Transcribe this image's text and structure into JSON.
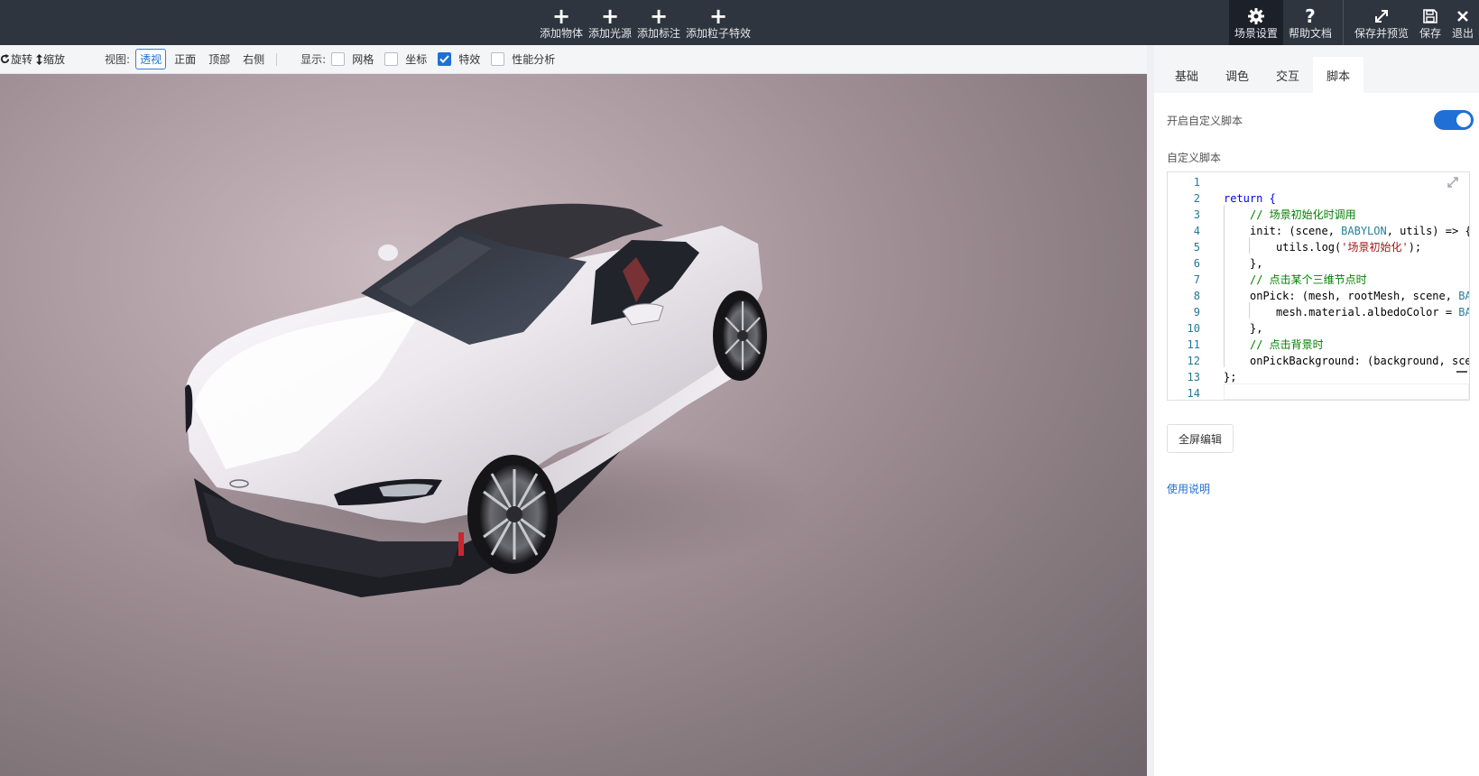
{
  "toolbar": {
    "add_object": "添加物体",
    "add_light": "添加光源",
    "add_label": "添加标注",
    "add_particle": "添加粒子特效",
    "scene_settings": "场景设置",
    "help_docs": "帮助文档",
    "save_preview": "保存并预览",
    "save": "保存",
    "exit": "退出"
  },
  "subbar": {
    "rotate": "旋转",
    "zoom": "缩放",
    "view_label": "视图:",
    "views": [
      "透视",
      "正面",
      "顶部",
      "右侧"
    ],
    "active_view": "透视",
    "display_label": "显示:",
    "options": [
      {
        "label": "网格",
        "checked": false
      },
      {
        "label": "坐标",
        "checked": false
      },
      {
        "label": "特效",
        "checked": true
      },
      {
        "label": "性能分析",
        "checked": false
      }
    ]
  },
  "panel": {
    "tabs": [
      "基础",
      "调色",
      "交互",
      "脚本"
    ],
    "active_tab": "脚本",
    "enable_script_label": "开启自定义脚本",
    "enable_script_on": true,
    "custom_script_label": "自定义脚本",
    "fullscreen_button": "全屏编辑",
    "usage_link": "使用说明"
  },
  "code": {
    "line_numbers": [
      "1",
      "2",
      "3",
      "4",
      "5",
      "6",
      "7",
      "8",
      "9",
      "10",
      "11",
      "12",
      "13",
      "14"
    ],
    "l2_kw": "return",
    "l2_rest": " {",
    "l3": "// 场景初始化时调用",
    "l4_a": "init: ",
    "l4_b": "(scene, ",
    "l4_c": "BABYLON",
    "l4_d": ", utils) => {",
    "l5_a": "utils.log(",
    "l5_b": "'场景初始化'",
    "l5_c": ");",
    "l6": "},",
    "l7": "// 点击某个三维节点时",
    "l8_a": "onPick: ",
    "l8_b": "(mesh, rootMesh, scene, ",
    "l8_c": "BA",
    "l9_a": "mesh.material.albedoColor = ",
    "l9_b": "BA",
    "l10": "},",
    "l11": "// 点击背景时",
    "l12": "onPickBackground: (background, sce",
    "l13": "};"
  },
  "colors": {
    "toolbar_bg": "#2f353f",
    "accent": "#1f6fd6",
    "car_body": "#e8e4ea",
    "viewport_center": "#cbbcc2"
  }
}
